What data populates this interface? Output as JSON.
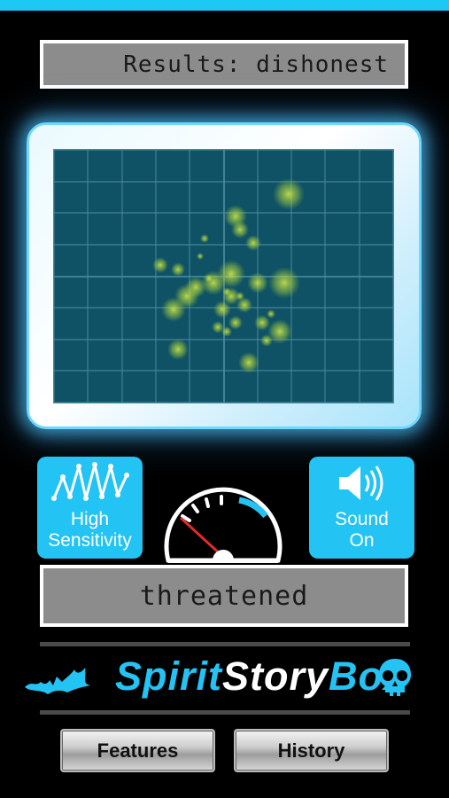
{
  "results_display": {
    "text": "Results: dishonest"
  },
  "scope": {
    "grid_color": "#4f8ea2",
    "background": "#0f5266",
    "blob_color": "#c8e63c"
  },
  "sensitivity_button": {
    "icon": "waveform-icon",
    "label_line1": "High",
    "label_line2": "Sensitivity"
  },
  "sound_button": {
    "icon": "speaker-icon",
    "label_line1": "Sound",
    "label_line2": "On"
  },
  "gauge": {
    "icon": "speedometer-icon",
    "level": 0.15
  },
  "status_display": {
    "text": "threatened"
  },
  "logo": {
    "part1": "Spirit",
    "part2": "Story",
    "part3": "Box",
    "left_icon": "bat-icon",
    "right_icon": "skull-icon"
  },
  "nav": {
    "features_label": "Features",
    "history_label": "History"
  },
  "colors": {
    "accent": "#23c3f3",
    "top_bar": "#1ec8f5"
  }
}
